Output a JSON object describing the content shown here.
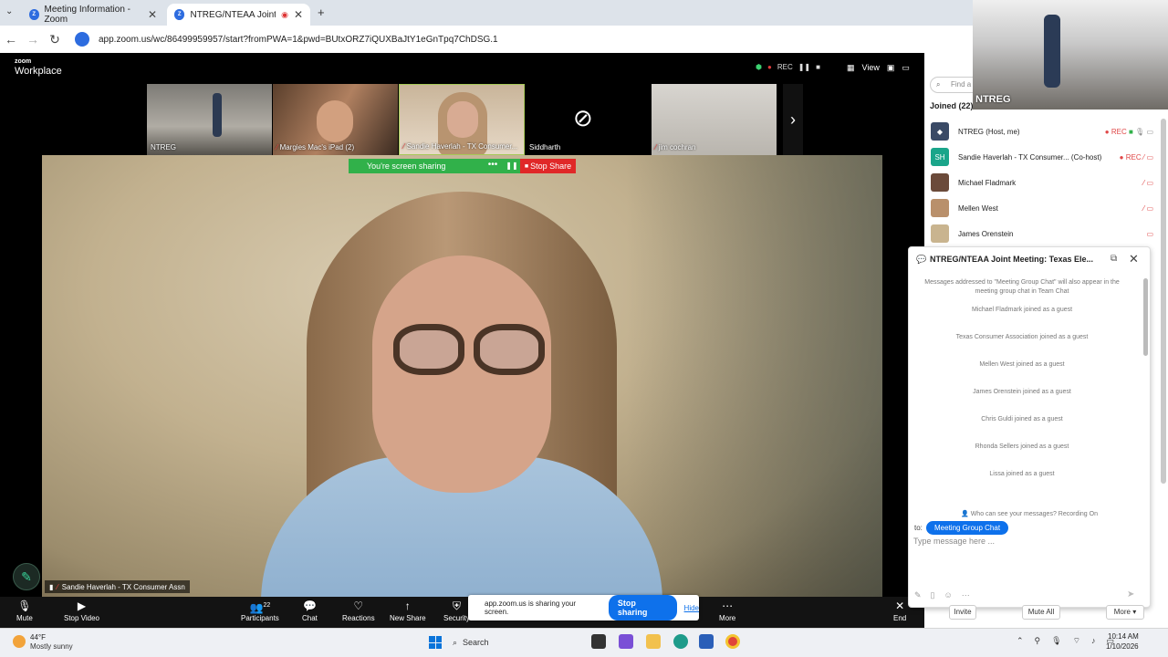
{
  "browser": {
    "tabs": [
      {
        "title": "Meeting Information - Zoom",
        "close": "✕"
      },
      {
        "title": "NTREG/NTEAA Joint Meetin",
        "close": "✕"
      }
    ],
    "new_tab": "+",
    "url": "app.zoom.us/wc/86499959957/start?fromPWA=1&pwd=BUtxORZ7iQUXBaJtY1eGnTpq7ChDSG.1"
  },
  "zoom": {
    "logo_top": "zoom",
    "logo_bottom": "Workplace",
    "rec": "REC",
    "view": "View",
    "thumbnails": [
      "NTREG",
      "Margies Mac's iPad (2)",
      "Sandie Haverlah - TX Consumer...",
      "Siddharth",
      "jim cochran"
    ],
    "share_banner": "You're screen sharing",
    "share_more": "•••",
    "stop_share": "Stop Share",
    "speaker": "Sandie Haverlah - TX Consumer Assn"
  },
  "toolbar": {
    "mute": "Mute",
    "stop_video": "Stop Video",
    "participants": "Participants",
    "participants_count": "22",
    "chat": "Chat",
    "reactions": "Reactions",
    "new_share": "New Share",
    "security": "Security",
    "more": "More",
    "end": "End"
  },
  "sharing_bar": {
    "message": "app.zoom.us is sharing your screen.",
    "stop": "Stop sharing",
    "hide": "Hide"
  },
  "participants_panel": {
    "find_placeholder": "Find a",
    "joined": "Joined (22)",
    "camera_label": "NTREG",
    "people": [
      {
        "name": "NTREG (Host, me)",
        "badge": "● REC",
        "color": "#3a4a66"
      },
      {
        "name": "Sandie Haverlah - TX Consumer... (Co-host)",
        "badge": "● REC",
        "initials": "SH",
        "color": "#1aa58a"
      },
      {
        "name": "Michael Fladmark",
        "badge": "",
        "color": "#6b4a3a"
      },
      {
        "name": "Mellen West",
        "badge": "",
        "color": "#b9906b"
      },
      {
        "name": "James Orenstein",
        "badge": "",
        "color": "#c9b48f"
      }
    ],
    "invite": "Invite",
    "mute_all": "Mute All",
    "more": "More ▾"
  },
  "chat": {
    "title": "NTREG/NTEAA Joint Meeting: Texas Ele...",
    "note": "Messages addressed to \"Meeting Group Chat\" will also appear in the meeting group chat in Team Chat",
    "messages": [
      "Michael Fladmark joined as a guest",
      "Texas Consumer Association joined as a guest",
      "Mellen West joined as a guest",
      "James Orenstein joined as a guest",
      "Chris Guldi joined as a guest",
      "Rhonda Sellers joined as a guest",
      "Lissa joined as a guest"
    ],
    "who_can_see": "Who can see your messages? Recording On",
    "to_label": "to:",
    "to_target": "Meeting Group Chat",
    "input_placeholder": "Type message here ..."
  },
  "taskbar": {
    "temp": "44°F",
    "weather": "Mostly sunny",
    "search": "Search",
    "time": "10:14 AM",
    "date": "1/10/2026"
  }
}
